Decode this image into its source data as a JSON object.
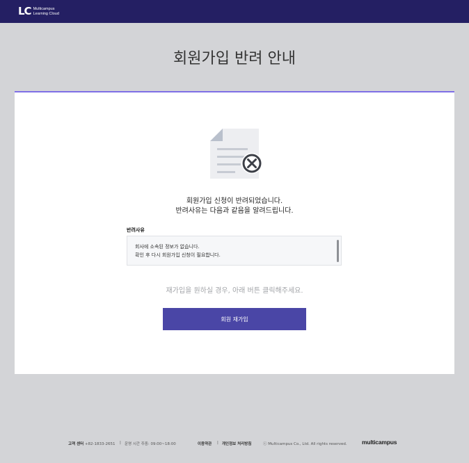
{
  "header": {
    "logo_mark": "LC",
    "logo_line1": "Multicampus",
    "logo_line2": "Learning Cloud"
  },
  "page": {
    "title": "회원가입 반려 안내"
  },
  "notice": {
    "icon": "document-rejected-icon",
    "line1": "회원가입 신청이 반려되었습니다.",
    "line2": "반려사유는 다음과 같음을 알려드립니다."
  },
  "reason": {
    "label": "반려사유",
    "line1": "회사에 소속된 정보가 없습니다.",
    "line2": "확인 후 다시 회원가입 신청이 필요합니다."
  },
  "rejoin": {
    "hint": "재가입을 원하실 경우, 아래 버튼 클릭해주세요.",
    "button_label": "회원 재가입"
  },
  "footer": {
    "support_label": "고객 센터",
    "support_phone": "+82-1833-2651",
    "hours": "운영 시간 주중: 09:00~18:00",
    "terms_link": "이용약관",
    "privacy_link": "개인정보 처리방침",
    "copyright": "ⓒ Multicampus Co., Ltd. All rights reserved.",
    "brand": "multicampus"
  },
  "colors": {
    "header_bg": "#241f63",
    "accent": "#7e6ee6",
    "button_bg": "#4a46a6",
    "page_bg": "#d3d4d7"
  }
}
